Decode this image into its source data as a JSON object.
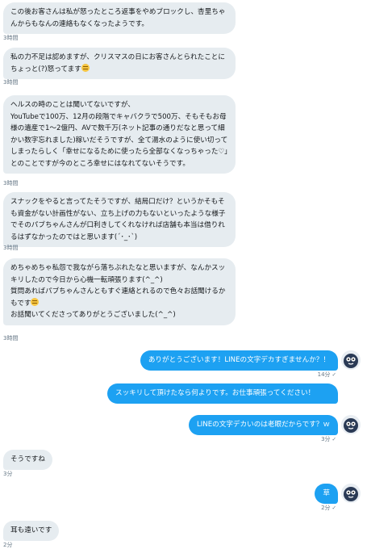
{
  "messages_in": [
    {
      "text": "この後お客さんは私が怒ったところ返事をやめブロックし、杏里ちゃんからもなんの連絡もなくなったようです。",
      "time": "3時間"
    },
    {
      "text": "私の力不足は認めますが、クリスマスの日にお客さんとられたことにちょっと(?)怒ってます",
      "time": "3時間",
      "emoji": "grimacing-emoji"
    },
    {
      "text": "ヘルスの時のことは聞いてないですが、\nYouTubeで100万、12月の段階でキャバクラで500万、そもそもお母様の遺産で1〜2億円、AVで数千万(ネット記事の通りだなと思って細かい数字忘れました)稼いだそうですが、全て湯水のように使い切ってしまったらしく「幸せになるために使ったら全部なくなっちゃった♡」とのことですが今のところ幸せにはなれてないそうです。",
      "time": "3時間"
    },
    {
      "text": "スナックをやると言ってたそうですが、結局口だけ？というかそもそも資金がない計画性がない、立ち上げの力もないといったような様子でそのパブちゃんさんが口利きしてくれなければ店舗も本当は借りれるはずなかったのではと思います(´･_･`)",
      "time": "3時間"
    },
    {
      "text": "めちゃめちゃ私怨で我ながら落ちぶれたなと思いますが、なんかスッキリしたので今日から心機一転頑張ります(^_^)\n質問あればパブちゃんさんともすぐ連絡とれるので色々お話聞けるかもです",
      "text2": "\nお話聞いてくださってありがとうございました(^_^)",
      "time": "3時間",
      "emoji": "grimacing-emoji"
    }
  ],
  "messages_out": [
    {
      "text": "ありがとうございます！LINEの文字デカすぎませんか？！",
      "time": "14分"
    },
    {
      "text": "スッキリして頂けたなら何よりです。お仕事頑張ってください！",
      "time": ""
    },
    {
      "text": "LINEの文字デカいのは老眼だからです？ｗ",
      "time": "3分"
    },
    {
      "text": "草",
      "time": "2分"
    }
  ],
  "replies_in": [
    {
      "text": "そうですね",
      "time": "3分"
    },
    {
      "text": "耳も遠いです",
      "time": "2分"
    }
  ],
  "colors": {
    "outgoing": "#1da1f2",
    "incoming": "#e6ecf0",
    "timestamp": "#657786"
  }
}
